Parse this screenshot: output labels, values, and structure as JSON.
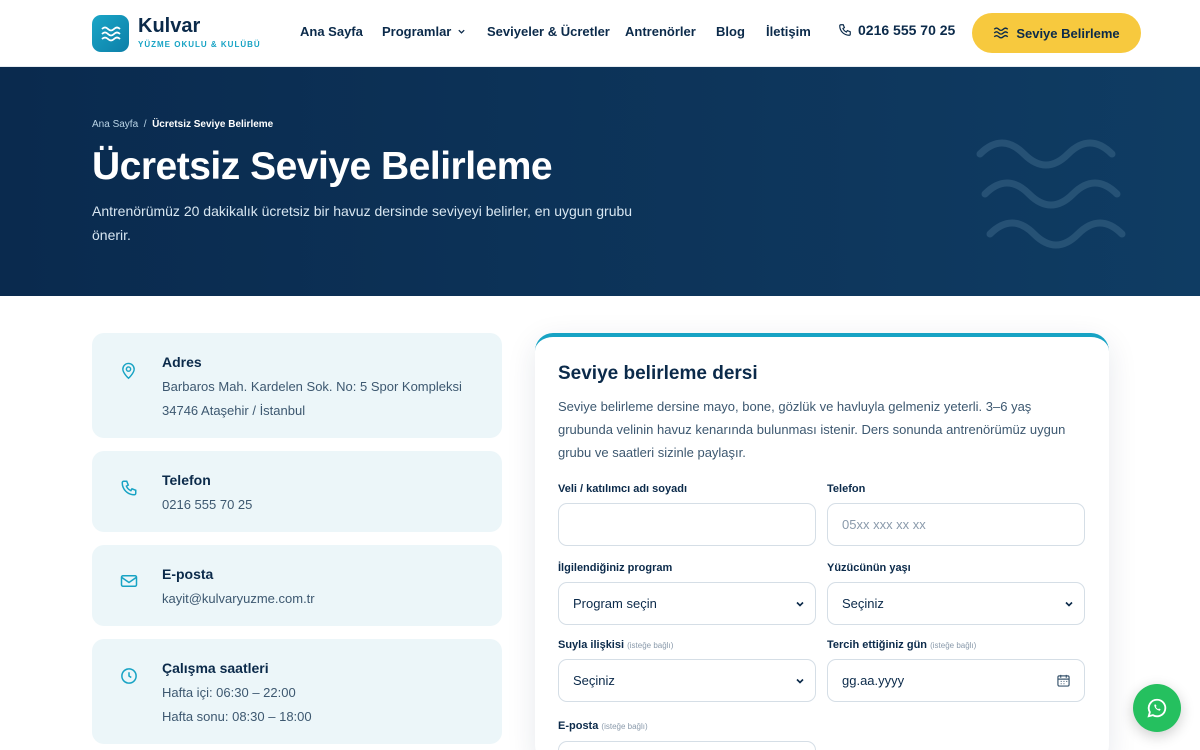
{
  "brand": {
    "name": "Kulvar",
    "tagline": "YÜZME OKULU & KULÜBÜ"
  },
  "nav": [
    {
      "label": "Ana Sayfa"
    },
    {
      "label": "Programlar"
    },
    {
      "label": "Seviyeler & Ücretler"
    },
    {
      "label": "Antrenörler"
    },
    {
      "label": "Blog"
    },
    {
      "label": "İletişim"
    }
  ],
  "header": {
    "phone": "0216 555 70 25",
    "cta_label": "Seviye Belirleme"
  },
  "hero": {
    "breadcrumb_home": "Ana Sayfa",
    "breadcrumb_sep": "/",
    "breadcrumb_current": "Ücretsiz Seviye Belirleme",
    "title": "Ücretsiz Seviye Belirleme",
    "subtitle": "Antrenörümüz 20 dakikalık ücretsiz bir havuz dersinde seviyeyi belirler, en uygun grubu önerir."
  },
  "info": {
    "address": {
      "title": "Adres",
      "line1": "Barbaros Mah. Kardelen Sok. No: 5 Spor Kompleksi",
      "line2": "34746 Ataşehir / İstanbul"
    },
    "phone": {
      "title": "Telefon",
      "line1": "0216 555 70 25"
    },
    "email": {
      "title": "E-posta",
      "line1": "kayit@kulvaryuzme.com.tr"
    },
    "hours": {
      "title": "Çalışma saatleri",
      "line1": "Hafta içi: 06:30 – 22:00",
      "line2": "Hafta sonu: 08:30 – 18:00"
    }
  },
  "form": {
    "title": "Seviye belirleme dersi",
    "description": "Seviye belirleme dersine mayo, bone, gözlük ve havluyla gelmeniz yeterli. 3–6 yaş grubunda velinin havuz kenarında bulunması istenir. Ders sonunda antrenörümüz uygun grubu ve saatleri sizinle paylaşır.",
    "name_label": "Veli / katılımcı adı soyadı",
    "name_value": "",
    "phone_label": "Telefon",
    "phone_placeholder": "05xx xxx xx xx",
    "program_label": "İlgilendiğiniz program",
    "program_value": "Program seçin",
    "age_label": "Yüzücünün yaşı",
    "age_value": "Seçiniz",
    "water_label": "Suyla ilişkisi",
    "water_optional": "(isteğe bağlı)",
    "water_value": "Seçiniz",
    "day_label": "Tercih ettiğiniz gün",
    "day_optional": "(isteğe bağlı)",
    "day_placeholder": "gg.aa.yyyy",
    "email_label": "E-posta",
    "email_optional": "(isteğe bağlı)"
  },
  "colors": {
    "navy": "#0b2a4a",
    "accent": "#17a3c4",
    "cta": "#f7c93e",
    "card": "#ecf6f9",
    "whatsapp": "#25c05f"
  },
  "icons": [
    "waves-icon",
    "chevron-down-icon",
    "phone-icon",
    "location-pin-icon",
    "mail-icon",
    "clock-icon",
    "calendar-icon",
    "whatsapp-icon"
  ]
}
